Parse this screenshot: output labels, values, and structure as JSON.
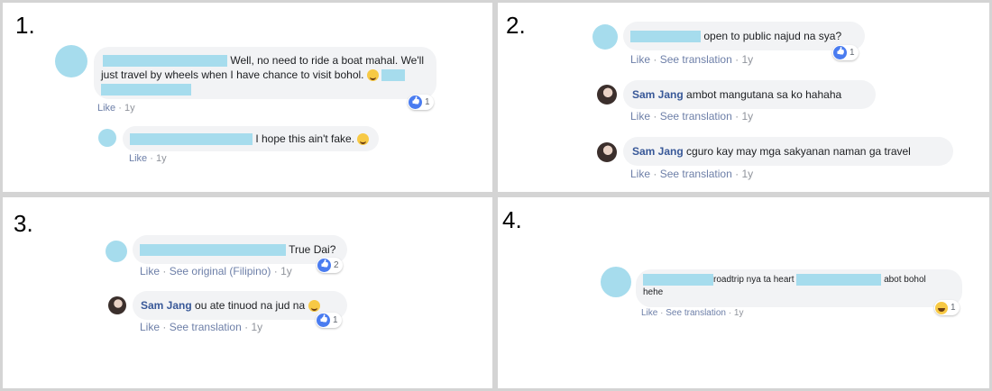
{
  "panels": {
    "p1": {
      "number": "1.",
      "c1_text": "Well, no need to ride a boat mahal. We'll just travel by wheels when I have chance to visit bohol.",
      "c1_react": "1",
      "c2_text": "I hope this ain't fake.",
      "meta_like": "Like",
      "meta_sep": "·",
      "meta_age": "1y"
    },
    "p2": {
      "number": "2.",
      "c1_text": "open to public najud na sya?",
      "c1_react": "1",
      "meta_like": "Like",
      "meta_translation": "See translation",
      "meta_sep": "·",
      "meta_age": "1y",
      "c2_name": "Sam Jang",
      "c2_text": "ambot mangutana sa ko hahaha",
      "c3_name": "Sam Jang",
      "c3_text": "cguro kay may mga sakyanan naman ga travel"
    },
    "p3": {
      "number": "3.",
      "c1_text": "True Dai?",
      "c1_react": "2",
      "c1_translation": "See original (Filipino)",
      "meta_like": "Like",
      "meta_sep": "·",
      "meta_age": "1y",
      "c2_name": "Sam Jang",
      "c2_text": "ou ate tinuod na jud na",
      "c2_react": "1",
      "c2_translation": "See translation"
    },
    "p4": {
      "number": "4.",
      "c1_text_a": "roadtrip nya ta heart",
      "c1_text_b": "abot bohol",
      "c1_text_c": "hehe",
      "c1_react": "1",
      "meta_like": "Like",
      "meta_translation": "See translation",
      "meta_sep": "·",
      "meta_age": "1y"
    }
  },
  "colors": {
    "redact": "#a6dced",
    "bubble": "#f2f3f5",
    "link": "#6d7fa8",
    "name": "#385898",
    "like_blue": "#4a7cf0"
  },
  "icons": {
    "like": "like-reaction-icon",
    "haha": "haha-reaction-icon",
    "smile": "smile-emoji-icon"
  }
}
